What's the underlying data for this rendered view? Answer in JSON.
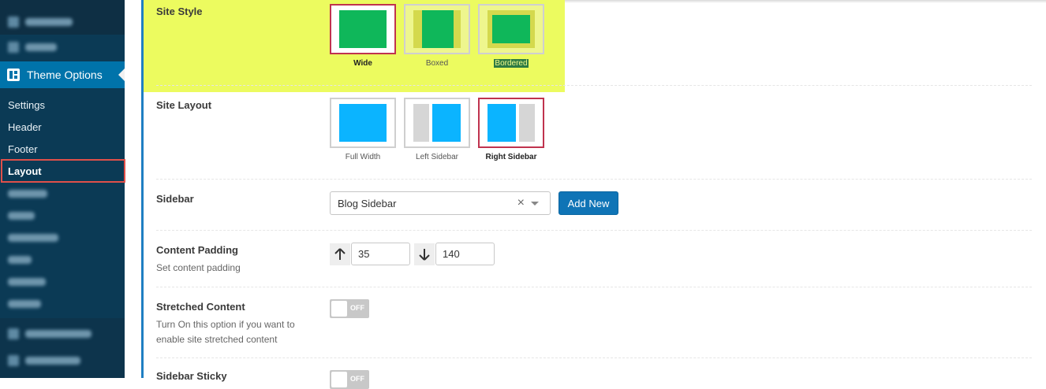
{
  "sidebar": {
    "theme_options_label": "Theme Options",
    "submenu": [
      "Settings",
      "Header",
      "Footer",
      "Layout"
    ],
    "active_item": "Layout"
  },
  "site_style": {
    "label": "Site Style",
    "options": [
      {
        "label": "Wide",
        "selected": true
      },
      {
        "label": "Boxed",
        "selected": false
      },
      {
        "label": "Bordered",
        "selected": false
      }
    ],
    "swatch_color": "#0fb75a"
  },
  "site_layout": {
    "label": "Site Layout",
    "options": [
      {
        "label": "Full Width",
        "selected": false
      },
      {
        "label": "Left Sidebar",
        "selected": false
      },
      {
        "label": "Right Sidebar",
        "selected": true
      }
    ],
    "swatch_color": "#0bb4ff"
  },
  "sidebar_field": {
    "label": "Sidebar",
    "value": "Blog Sidebar",
    "clear_glyph": "×",
    "add_new_label": "Add New"
  },
  "content_padding": {
    "label": "Content Padding",
    "description": "Set content padding",
    "top_icon": "arrow-up-icon",
    "top_value": "35",
    "bottom_icon": "arrow-down-icon",
    "bottom_value": "140"
  },
  "stretched_content": {
    "label": "Stretched Content",
    "description_line1": "Turn On this option if you want to",
    "description_line2": "enable site stretched content",
    "state": "OFF"
  },
  "sidebar_sticky": {
    "label": "Sidebar Sticky",
    "state": "OFF"
  },
  "colors": {
    "highlight": "#ecfb5f",
    "selected_border": "#c0334e",
    "primary": "#0f74b6"
  }
}
